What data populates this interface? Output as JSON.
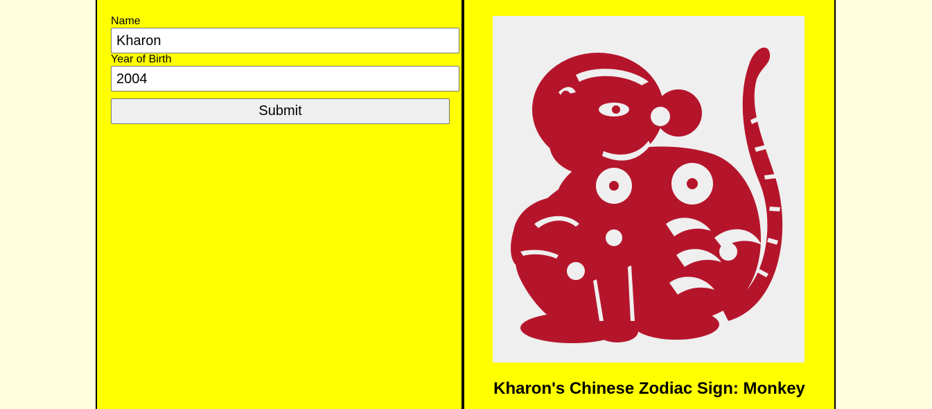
{
  "form": {
    "name_label": "Name",
    "name_value": "Kharon",
    "year_label": "Year of Birth",
    "year_value": "2004",
    "submit_label": "Submit"
  },
  "result": {
    "image_icon": "monkey-papercut-icon",
    "sign_text": "Kharon's Chinese Zodiac Sign: Monkey"
  },
  "colors": {
    "page_bg": "#fffede",
    "panel_bg": "#ffff00",
    "image_bg": "#efefef",
    "papercut_red": "#b5152b"
  }
}
